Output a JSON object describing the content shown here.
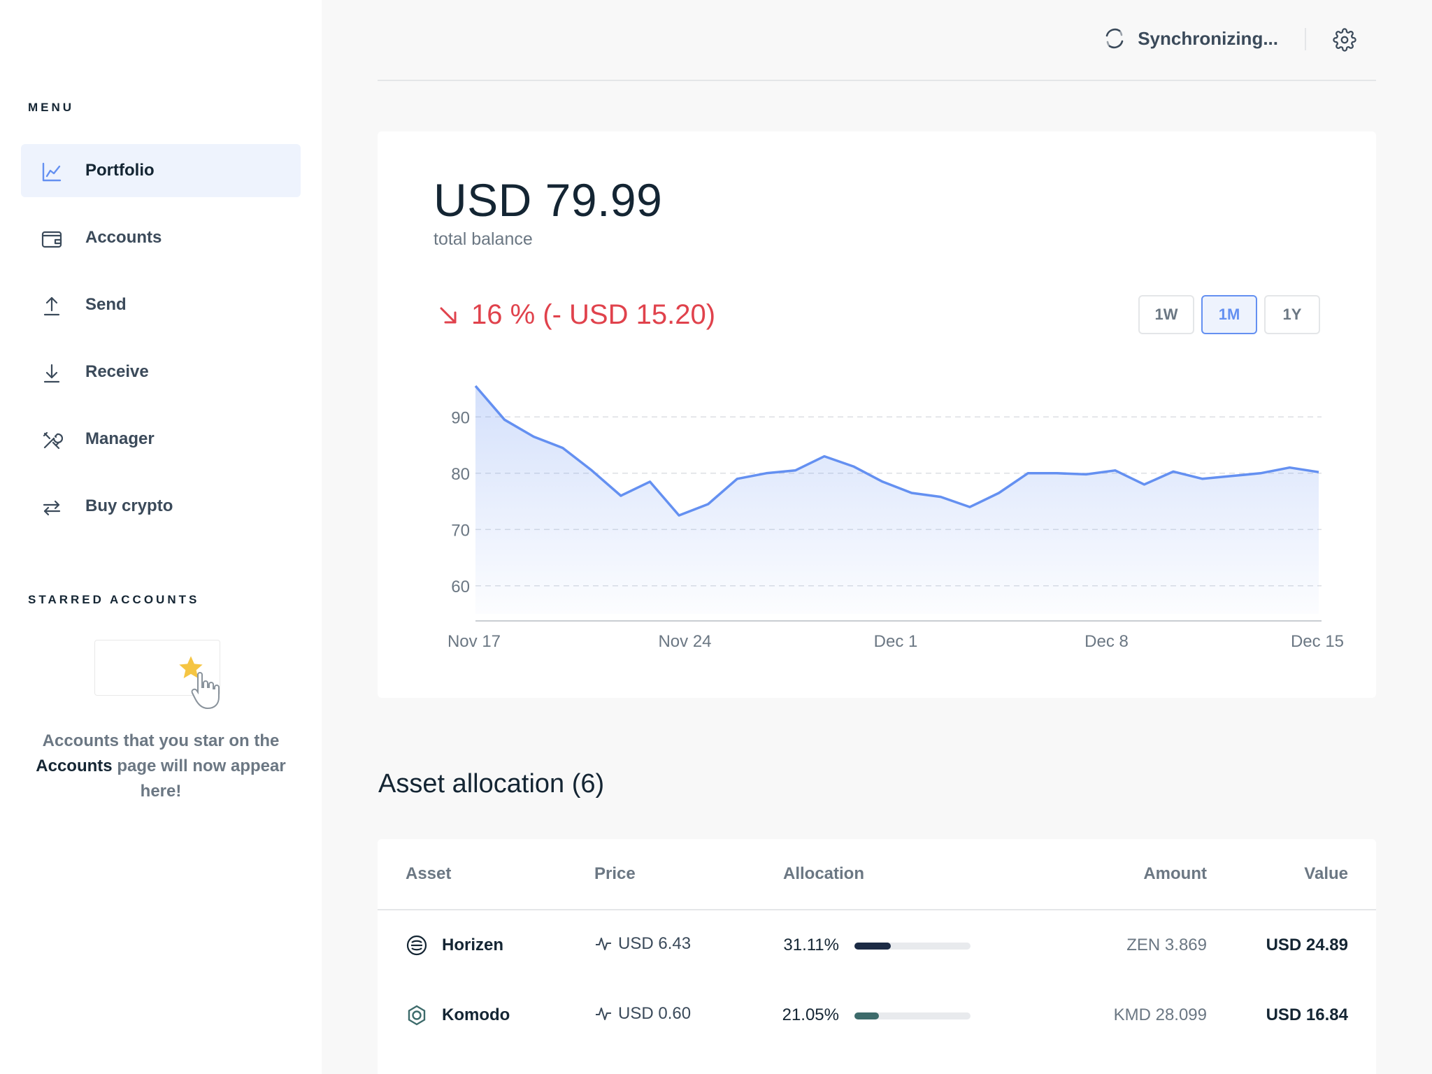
{
  "sidebar": {
    "menu_title": "MENU",
    "items": [
      {
        "label": "Portfolio"
      },
      {
        "label": "Accounts"
      },
      {
        "label": "Send"
      },
      {
        "label": "Receive"
      },
      {
        "label": "Manager"
      },
      {
        "label": "Buy crypto"
      }
    ],
    "starred_title": "STARRED ACCOUNTS",
    "starred_text_before": "Accounts that you star on the",
    "starred_text_bold": "Accounts",
    "starred_text_after": "page will now appear here!"
  },
  "topbar": {
    "sync_label": "Synchronizing..."
  },
  "balance": {
    "amount": "USD 79.99",
    "label": "total balance",
    "delta_text": "16 % (- USD 15.20)",
    "ranges": [
      "1W",
      "1M",
      "1Y"
    ],
    "active_range": "1M"
  },
  "colors": {
    "accent": "#6490f1",
    "negative": "#e0424c"
  },
  "chart_data": {
    "type": "area",
    "x_ticks": [
      "Nov 17",
      "Nov 24",
      "Dec 1",
      "Dec 8",
      "Dec 15"
    ],
    "y_ticks": [
      60,
      70,
      80,
      90
    ],
    "ylim": [
      55,
      96
    ],
    "grid": true,
    "values": [
      95.5,
      89.5,
      86.5,
      84.5,
      80.5,
      76,
      78.5,
      72.5,
      74.5,
      79,
      80,
      80.5,
      83,
      81.2,
      78.5,
      76.5,
      75.8,
      74,
      76.5,
      80,
      80,
      79.8,
      80.5,
      78,
      80.3,
      79,
      79.5,
      80,
      81,
      80.2
    ]
  },
  "allocation": {
    "title": "Asset allocation (6)",
    "columns": {
      "asset": "Asset",
      "price": "Price",
      "allocation": "Allocation",
      "amount": "Amount",
      "value": "Value"
    },
    "rows": [
      {
        "name": "Horizen",
        "icon": "horizen-icon",
        "price": "USD 6.43",
        "pct": "31.11%",
        "fraction": 0.3111,
        "bar_color": "#1c2b45",
        "amount": "ZEN 3.869",
        "value": "USD 24.89"
      },
      {
        "name": "Komodo",
        "icon": "komodo-icon",
        "price": "USD 0.60",
        "pct": "21.05%",
        "fraction": 0.2105,
        "bar_color": "#3d6b6b",
        "amount": "KMD 28.099",
        "value": "USD 16.84"
      }
    ]
  }
}
